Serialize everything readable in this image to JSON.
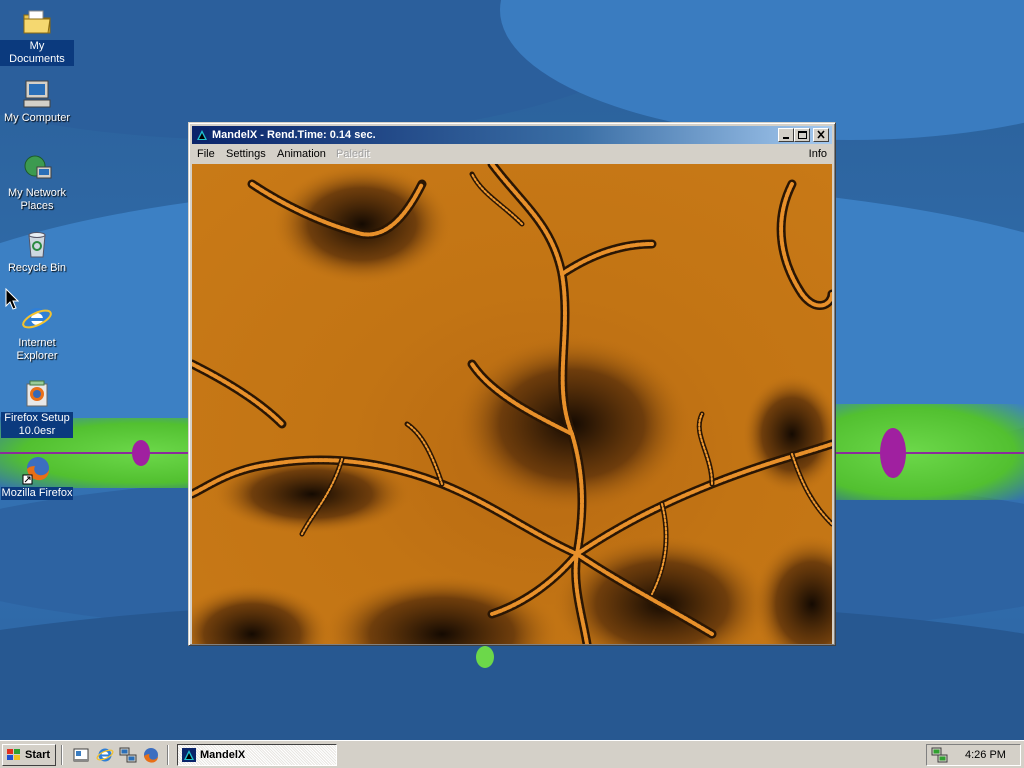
{
  "desktop": {
    "icons": [
      {
        "label": "My Documents",
        "icon": "folder-documents-icon"
      },
      {
        "label": "My Computer",
        "icon": "computer-icon"
      },
      {
        "label": "My Network Places",
        "icon": "network-places-icon"
      },
      {
        "label": "Recycle Bin",
        "icon": "recycle-bin-icon"
      },
      {
        "label": "Internet Explorer",
        "icon": "internet-explorer-icon"
      },
      {
        "label": "Firefox Setup 10.0esr",
        "icon": "installer-icon"
      },
      {
        "label": "Mozilla Firefox",
        "icon": "firefox-icon"
      }
    ],
    "colors": {
      "background": "#2f69a6",
      "selection": "#0b3a7e",
      "wave_green": "#5cc83a",
      "fractal_accent": "#a020a0"
    }
  },
  "window": {
    "title": "MandelX - Rend.Time:  0.14 sec.",
    "icon": "mandelx-app-icon",
    "menu": [
      {
        "label": "File",
        "disabled": false
      },
      {
        "label": "Settings",
        "disabled": false
      },
      {
        "label": "Animation",
        "disabled": false
      },
      {
        "label": "Paledit",
        "disabled": true
      }
    ],
    "info_label": "Info",
    "colors": {
      "titlebar_start": "#0a246a",
      "titlebar_end": "#a6caf0",
      "fractal_base": "#c27414",
      "fractal_dark": "#1a0e04"
    }
  },
  "taskbar": {
    "start_label": "Start",
    "quicklaunch": [
      "show-desktop-icon",
      "internet-explorer-icon",
      "network-icon",
      "firefox-icon"
    ],
    "task_label": "MandelX",
    "clock": "4:26 PM",
    "tray_icon": "network-tray-icon"
  }
}
